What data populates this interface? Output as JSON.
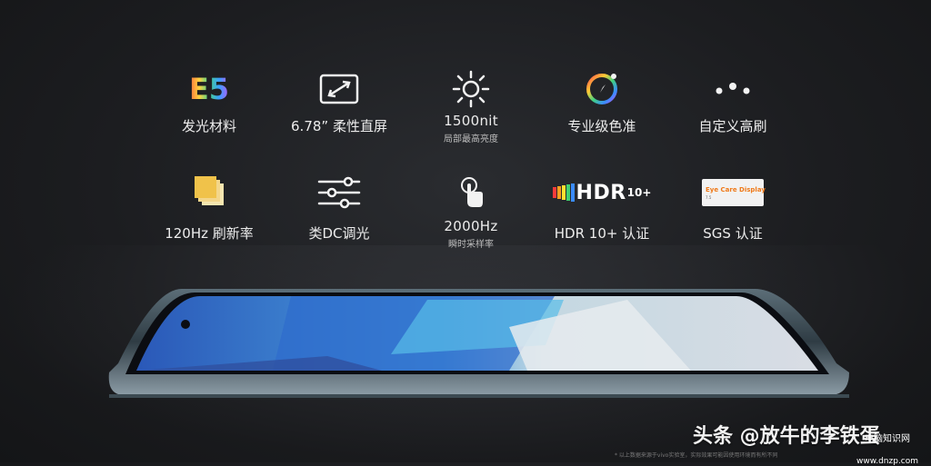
{
  "features": [
    {
      "id": "e5",
      "label": "发光材料",
      "icon_text": "E5"
    },
    {
      "id": "screen",
      "label": "6.78” 柔性直屏",
      "icon": "resize-screen-icon"
    },
    {
      "id": "nit",
      "label": "1500nit",
      "sub": "局部最高亮度",
      "icon": "sun-icon"
    },
    {
      "id": "color",
      "label": "专业级色准",
      "icon": "color-wheel-icon"
    },
    {
      "id": "refresh",
      "label": "自定义高刷",
      "icon": "three-dots-icon"
    },
    {
      "id": "hz",
      "label": "120Hz 刷新率",
      "icon": "stacked-layers-icon"
    },
    {
      "id": "dc",
      "label": "类DC调光",
      "icon": "sliders-icon"
    },
    {
      "id": "touch",
      "label": "2000Hz",
      "sub": "瞬时采样率",
      "icon": "touch-tap-icon"
    },
    {
      "id": "hdr",
      "label": "HDR 10+ 认证",
      "icon_text": "HDR",
      "icon_sup": "10+"
    },
    {
      "id": "sgs",
      "label": "SGS 认证",
      "icon_text": "Eye Care Display",
      "icon_sub": "7.5"
    }
  ],
  "watermark": {
    "text": "头条 @放牛的李铁蛋",
    "logo_text": "电脑知识网",
    "logo_url": "www.dnzp.com"
  },
  "footnote": "* 以上数据来源于vivo实验室，实际效果可能因使用环境而有所不同",
  "colors": {
    "background": "#1c1d20",
    "text": "#ececec",
    "accent_orange": "#ef7a1a"
  }
}
